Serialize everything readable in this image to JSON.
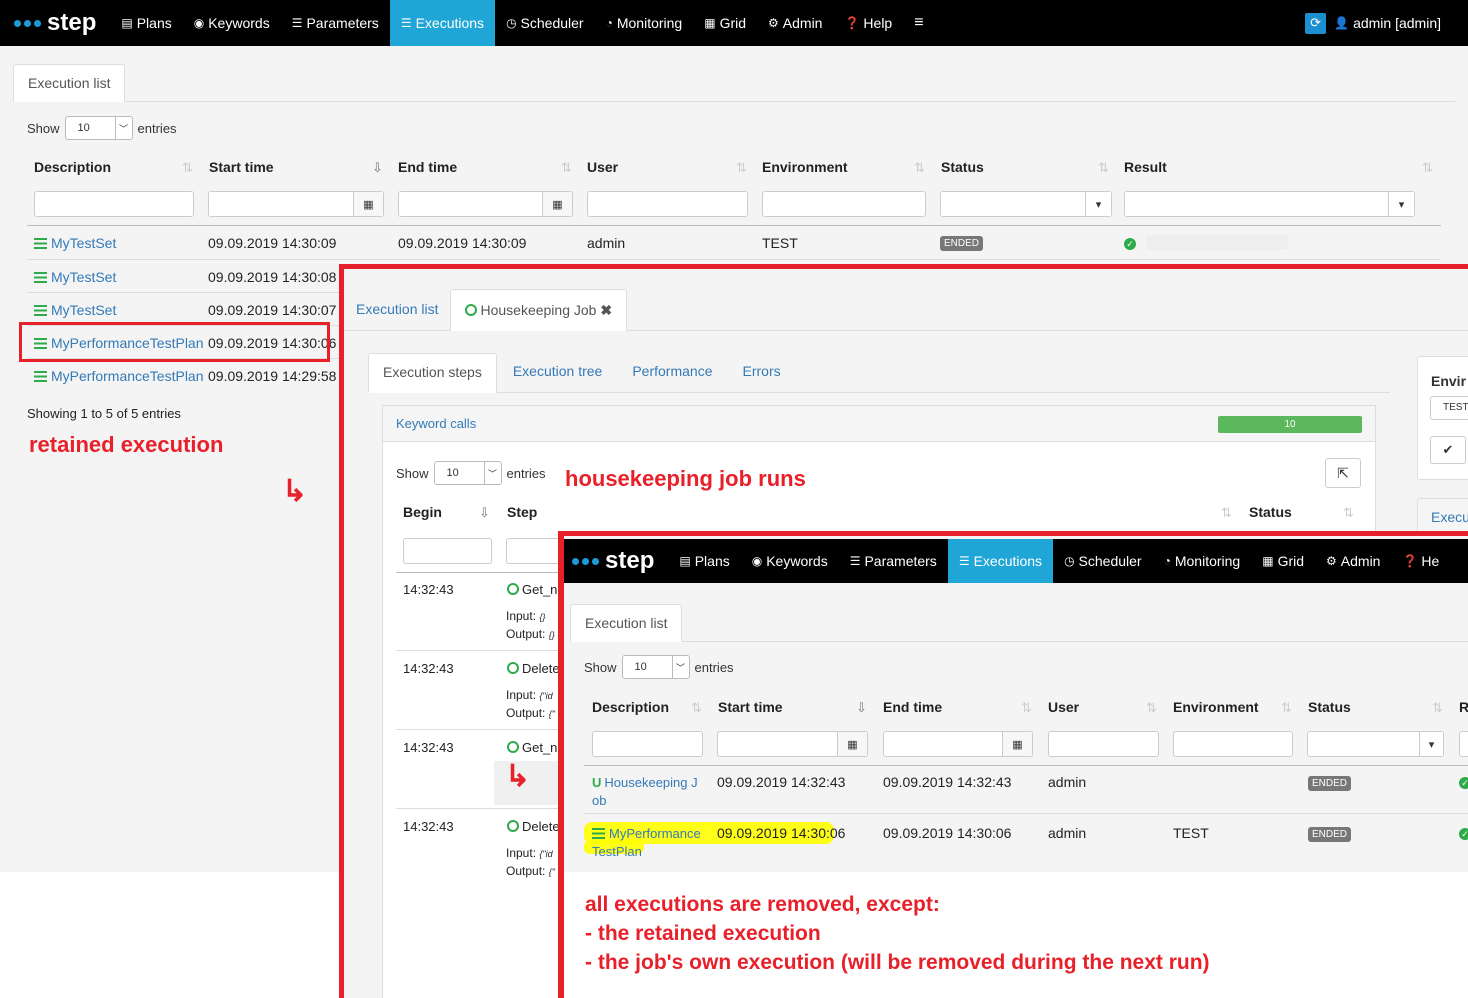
{
  "app": {
    "logo": "step",
    "brand_color": "#1fa5d6"
  },
  "nav1": {
    "items": [
      {
        "icon": "file-icon",
        "label": "Plans"
      },
      {
        "icon": "target-icon",
        "label": "Keywords"
      },
      {
        "icon": "list-icon",
        "label": "Parameters"
      },
      {
        "icon": "tasks-icon",
        "label": "Executions"
      },
      {
        "icon": "clock-icon",
        "label": "Scheduler"
      },
      {
        "icon": "dashboard-icon",
        "label": "Monitoring"
      },
      {
        "icon": "grid-icon",
        "label": "Grid"
      },
      {
        "icon": "gear-icon",
        "label": "Admin"
      },
      {
        "icon": "question-icon",
        "label": "Help"
      }
    ],
    "user": "admin [admin]"
  },
  "nav3": {
    "items": [
      {
        "label": "Plans"
      },
      {
        "label": "Keywords"
      },
      {
        "label": "Parameters"
      },
      {
        "label": "Executions"
      },
      {
        "label": "Scheduler"
      },
      {
        "label": "Monitoring"
      },
      {
        "label": "Grid"
      },
      {
        "label": "Admin"
      },
      {
        "label": "He"
      }
    ]
  },
  "panel1": {
    "tab": "Execution list",
    "show": "Show",
    "length": "10",
    "entries": "entries",
    "columns": [
      "Description",
      "Start time",
      "End time",
      "User",
      "Environment",
      "Status",
      "Result"
    ],
    "rows": [
      {
        "desc": "MyTestSet",
        "start": "09.09.2019 14:30:09",
        "end": "09.09.2019 14:30:09",
        "user": "admin",
        "env": "TEST",
        "status": "ENDED"
      },
      {
        "desc": "MyTestSet",
        "start": "09.09.2019 14:30:08"
      },
      {
        "desc": "MyTestSet",
        "start": "09.09.2019 14:30:07"
      },
      {
        "desc": "MyPerformanceTestPlan",
        "start": "09.09.2019 14:30:06"
      },
      {
        "desc": "MyPerformanceTestPlan",
        "start": "09.09.2019 14:29:58"
      }
    ],
    "info": "Showing 1 to 5 of 5 entries"
  },
  "panel2": {
    "tabs": [
      "Execution list",
      "Housekeeping Job"
    ],
    "subtabs": [
      "Execution steps",
      "Execution tree",
      "Performance",
      "Errors"
    ],
    "keyword_calls": "Keyword calls",
    "keyword_count": "10",
    "show": "Show",
    "length": "10",
    "entries": "entries",
    "columns": [
      "Begin",
      "Step",
      "Status"
    ],
    "steps": [
      {
        "time": "14:32:43",
        "step": "Get_n",
        "input": "Input:",
        "input_val": "{}",
        "output": "Output:",
        "output_val": "{}"
      },
      {
        "time": "14:32:43",
        "step": "Delete",
        "input": "Input:",
        "input_val": "{\"id",
        "output": "Output:",
        "output_val": "{\""
      },
      {
        "time": "14:32:43",
        "step": "Get_n"
      },
      {
        "time": "14:32:43",
        "step": "Delete",
        "input": "Input:",
        "input_val": "{\"id",
        "output": "Output:",
        "output_val": "{\""
      }
    ],
    "side_title": "Envir",
    "side_value": "TEST",
    "side_link": "Execu"
  },
  "panel3": {
    "tab": "Execution list",
    "show": "Show",
    "length": "10",
    "entries": "entries",
    "columns": [
      "Description",
      "Start time",
      "End time",
      "User",
      "Environment",
      "Status",
      "R"
    ],
    "rows": [
      {
        "desc1": "Housekeeping J",
        "desc2": "ob",
        "start": "09.09.2019 14:32:43",
        "end": "09.09.2019 14:32:43",
        "user": "admin",
        "env": "",
        "status": "ENDED"
      },
      {
        "desc1": "MyPerformance",
        "desc2": "TestPlan",
        "start": "09.09.2019 14:30:06",
        "end": "09.09.2019 14:30:06",
        "user": "admin",
        "env": "TEST",
        "status": "ENDED"
      }
    ]
  },
  "annotations": {
    "retained": "retained execution",
    "housekeeping": "housekeeping job runs",
    "removed_1": "all executions are removed, except:",
    "removed_2": "- the retained execution",
    "removed_3": "- the job's own execution (will be removed during the next run)",
    "color": "#e8202a",
    "highlight": "#ffff00"
  }
}
